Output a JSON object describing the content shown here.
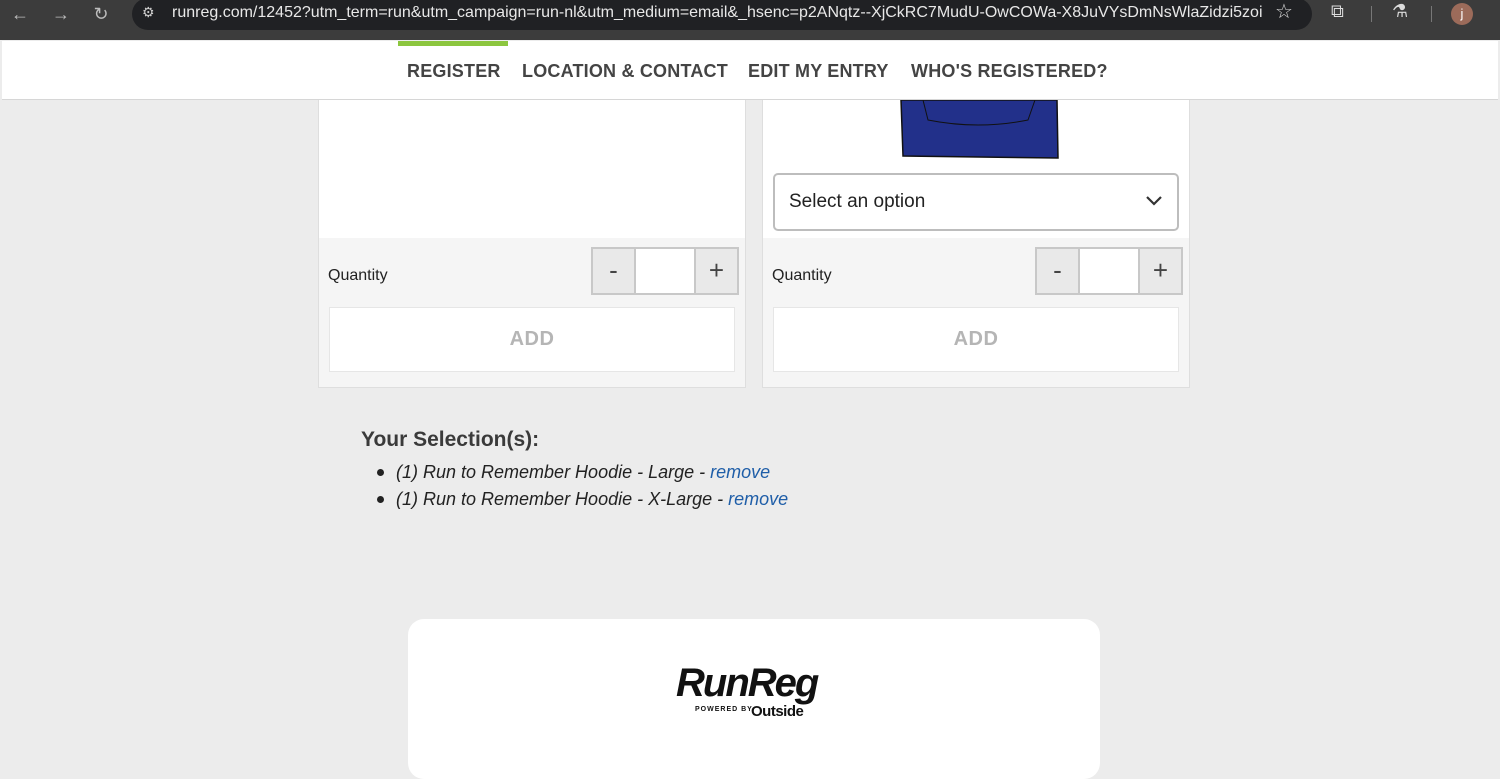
{
  "browser": {
    "url": "runreg.com/12452?utm_term=run&utm_campaign=run-nl&utm_medium=email&_hsenc=p2ANqtz--XjCkRC7MudU-OwCOWa-X8JuVYsDmNsWlaZidzi5zoig...",
    "back_icon": "←",
    "forward_icon": "→",
    "reload_icon": "↻",
    "site_info_icon": "⚙",
    "star_icon": "☆",
    "extensions_icon": "⧉",
    "labs_icon": "⚗",
    "avatar_letter": "j"
  },
  "nav": {
    "items": [
      "REGISTER",
      "LOCATION & CONTACT",
      "EDIT MY ENTRY",
      "WHO'S REGISTERED?"
    ],
    "active": "REGISTER"
  },
  "products": [
    {
      "quantity_label": "Quantity",
      "minus": "-",
      "plus": "+",
      "add_label": "ADD"
    },
    {
      "select_value": "Select an option",
      "quantity_label": "Quantity",
      "minus": "-",
      "plus": "+",
      "add_label": "ADD"
    }
  ],
  "selections": {
    "title": "Your Selection(s):",
    "items": [
      {
        "text": "(1) Run to Remember Hoodie - Large - ",
        "link": "remove"
      },
      {
        "text": "(1) Run to Remember Hoodie - X-Large - ",
        "link": "remove"
      }
    ]
  },
  "footer": {
    "logo": "RunReg",
    "powered_by": "POWERED BY",
    "partner": "Outside"
  },
  "colors": {
    "accent": "#8cc63f",
    "link": "#1f5ea8",
    "hoodie": "#22308a"
  }
}
